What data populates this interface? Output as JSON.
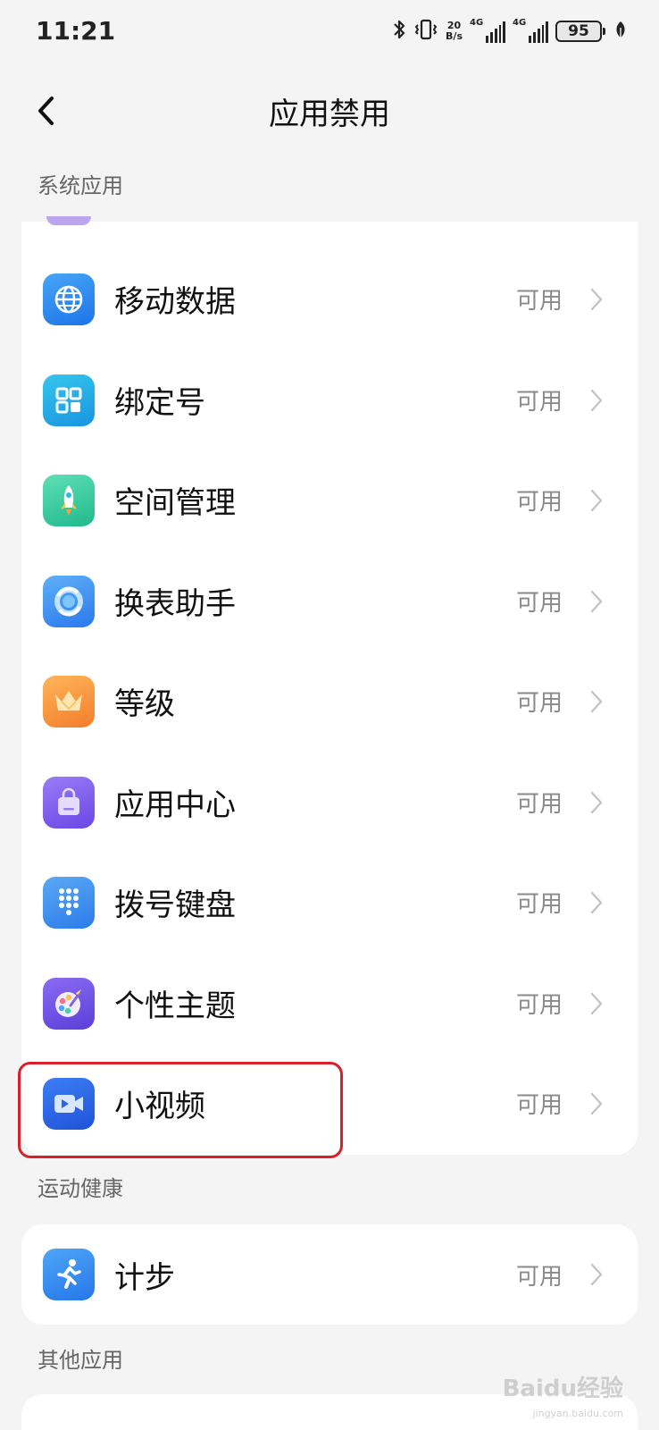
{
  "status_bar": {
    "time": "11:21",
    "speed_value": "20",
    "speed_unit": "B/s",
    "net1": "4G",
    "net2": "4G",
    "battery": "95",
    "icons": [
      "bluetooth-icon",
      "vibrate-icon",
      "signal-icon",
      "battery-icon",
      "leaf-icon"
    ]
  },
  "header": {
    "title": "应用禁用",
    "back_icon": "chevron-left-icon"
  },
  "sections": {
    "system": "系统应用",
    "sport": "运动健康",
    "other": "其他应用"
  },
  "system_apps": [
    {
      "label": "移动数据",
      "status": "可用",
      "icon": "globe-icon",
      "color": "#2f8cf0"
    },
    {
      "label": "绑定号",
      "status": "可用",
      "icon": "grid-icon",
      "color": "#1fb2e6"
    },
    {
      "label": "空间管理",
      "status": "可用",
      "icon": "rocket-icon",
      "color": "#2ec9a0"
    },
    {
      "label": "换表助手",
      "status": "可用",
      "icon": "sync-icon",
      "color": "#3a8ff2"
    },
    {
      "label": "等级",
      "status": "可用",
      "icon": "crown-icon",
      "color": "#f59a3b"
    },
    {
      "label": "应用中心",
      "status": "可用",
      "icon": "bag-icon",
      "color": "#7a5cf0"
    },
    {
      "label": "拨号键盘",
      "status": "可用",
      "icon": "dialpad-icon",
      "color": "#3b8ef0"
    },
    {
      "label": "个性主题",
      "status": "可用",
      "icon": "palette-icon",
      "color": "#6e4de0"
    },
    {
      "label": "小视频",
      "status": "可用",
      "icon": "video-icon",
      "color": "#2d6cf0"
    }
  ],
  "sport_apps": [
    {
      "label": "计步",
      "status": "可用",
      "icon": "running-icon",
      "color": "#2f8ff0"
    }
  ],
  "watermark": {
    "text": "Baidu经验",
    "sub": "jingyan.baidu.com"
  }
}
